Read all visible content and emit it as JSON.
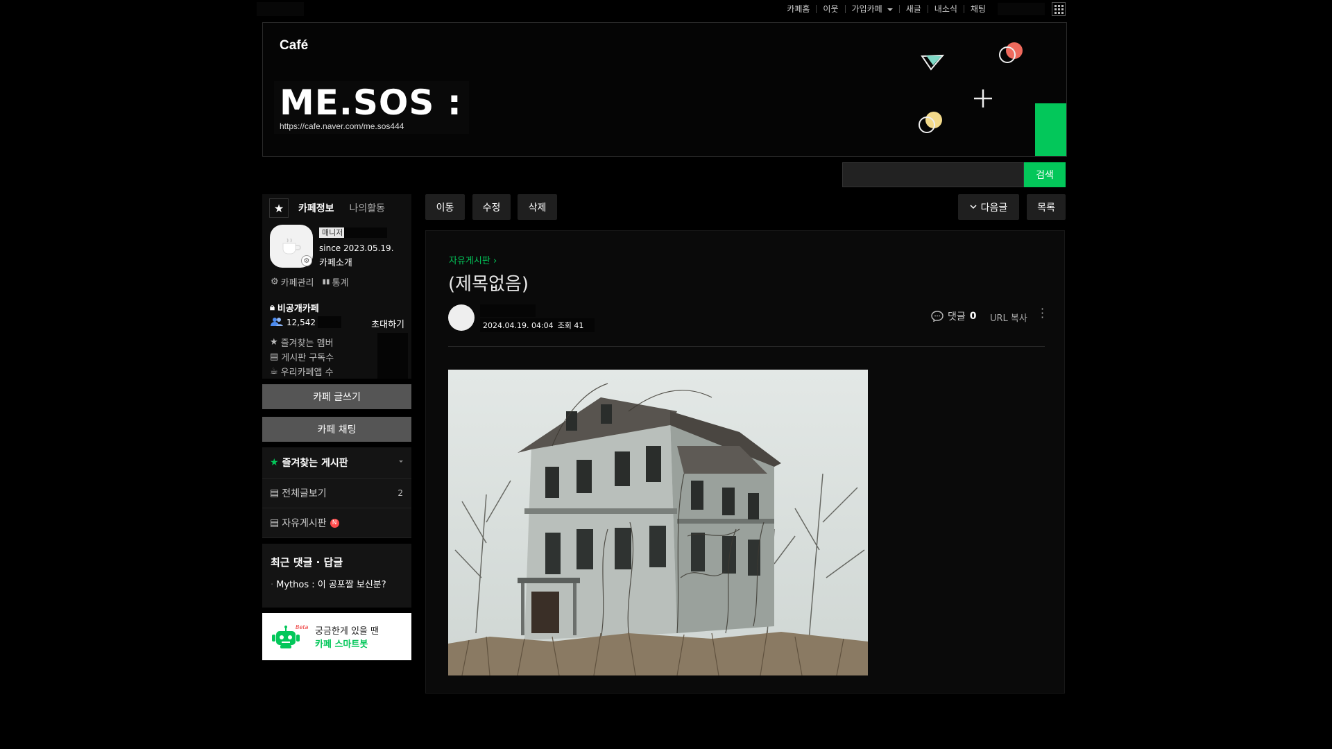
{
  "topnav": {
    "items": [
      "카페홈",
      "이웃",
      "가입카페",
      "새글",
      "내소식",
      "채팅"
    ]
  },
  "banner": {
    "logo": "Café",
    "title": "ME.SOS :",
    "url": "https://cafe.naver.com/me.sos444"
  },
  "search": {
    "button": "검색"
  },
  "sidebar": {
    "tabs": [
      "카페정보",
      "나의활동"
    ],
    "manager_label": "매니저",
    "since": "since 2023.05.19.",
    "intro": "카페소개",
    "admin": "카페관리",
    "stats_link": "통계",
    "private": "비공개카페",
    "member_count": "12,542",
    "invite": "초대하기",
    "stats": [
      "즐겨찾는 멤버",
      "게시판 구독수",
      "우리카페앱 수"
    ],
    "write_button": "카페 글쓰기",
    "chat_button": "카페 채팅",
    "favorites_title": "즐겨찾는 게시판",
    "menu": [
      {
        "label": "전체글보기",
        "count": "2"
      },
      {
        "label": "자유게시판",
        "badge": "N"
      }
    ],
    "recent_title": "최근 댓글 · 답글",
    "recent_item": "Mythos : 이 공포짤 보신분?",
    "smartbot_beta": "Beta",
    "smartbot_line1": "궁금한게 있을 땐",
    "smartbot_line2": "카페 스마트봇"
  },
  "actions": {
    "move": "이동",
    "edit": "수정",
    "delete": "삭제",
    "next": "다음글",
    "list": "목록"
  },
  "article": {
    "board": "자유게시판",
    "title": "(제목없음)",
    "date": "2024.04.19. 04:04",
    "views": "조회 41",
    "comment_label": "댓글",
    "comment_count": "0",
    "url_copy": "URL 복사"
  },
  "colors": {
    "accent": "#03c75a",
    "background": "#000000"
  }
}
